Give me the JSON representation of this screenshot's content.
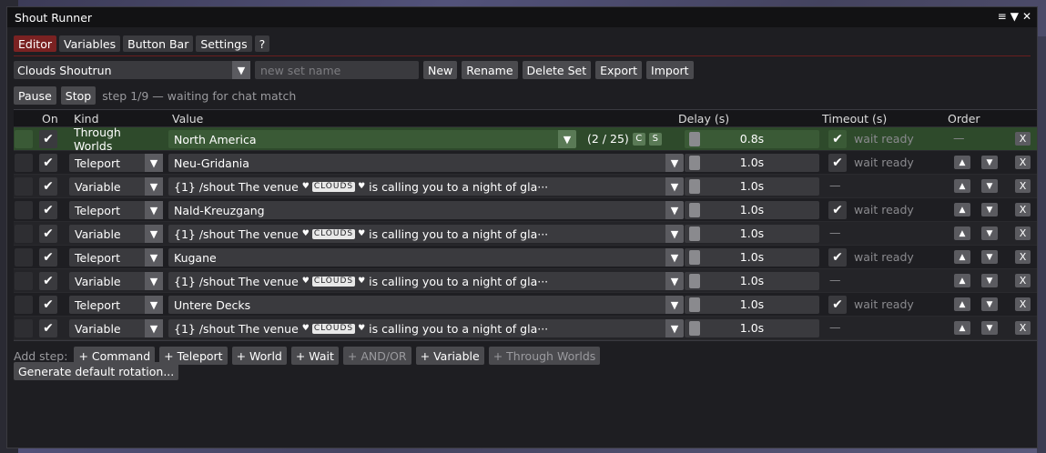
{
  "window": {
    "title": "Shout Runner",
    "icons": [
      "menu-icon",
      "collapse-icon",
      "close-icon"
    ]
  },
  "tabs": [
    "Editor",
    "Variables",
    "Button Bar",
    "Settings",
    "?"
  ],
  "toolbar": {
    "set_name": "Clouds Shoutrun",
    "new_set_placeholder": "new set name",
    "buttons": [
      "New",
      "Rename",
      "Delete Set",
      "Export",
      "Import"
    ]
  },
  "controls": {
    "pause": "Pause",
    "stop": "Stop",
    "status": "step 1/9 — waiting for chat match"
  },
  "columns": {
    "on": "On",
    "kind": "Kind",
    "value": "Value",
    "delay": "Delay (s)",
    "timeout": "Timeout (s)",
    "order": "Order"
  },
  "shout_prefix": "{1} /shout The venue ",
  "shout_clouds": "CLOUDS",
  "shout_suffix": " is calling you to a night of gla···",
  "steps": [
    {
      "kind": "Through Worlds",
      "value": "North America",
      "extra": "(2 / 25)",
      "extra_buttons": [
        "C",
        "S"
      ],
      "delay": "0.8s",
      "timeout": "wait ready",
      "order_dash": "—",
      "highlighted": true
    },
    {
      "kind": "Teleport",
      "value": "Neu-Gridania",
      "delay": "1.0s",
      "timeout": "wait ready"
    },
    {
      "kind": "Variable",
      "shout": true,
      "delay": "1.0s",
      "timeout_dash": "—"
    },
    {
      "kind": "Teleport",
      "value": "Nald-Kreuzgang",
      "delay": "1.0s",
      "timeout": "wait ready"
    },
    {
      "kind": "Variable",
      "shout": true,
      "delay": "1.0s",
      "timeout_dash": "—"
    },
    {
      "kind": "Teleport",
      "value": "Kugane",
      "delay": "1.0s",
      "timeout": "wait ready"
    },
    {
      "kind": "Variable",
      "shout": true,
      "delay": "1.0s",
      "timeout_dash": "—"
    },
    {
      "kind": "Teleport",
      "value": "Untere Decks",
      "delay": "1.0s",
      "timeout": "wait ready"
    },
    {
      "kind": "Variable",
      "shout": true,
      "delay": "1.0s",
      "timeout_dash": "—"
    }
  ],
  "add_step": {
    "label": "Add step:",
    "buttons": [
      {
        "label": "+ Command",
        "enabled": true
      },
      {
        "label": "+ Teleport",
        "enabled": true
      },
      {
        "label": "+ World",
        "enabled": true
      },
      {
        "label": "+ Wait",
        "enabled": true
      },
      {
        "label": "+ AND/OR",
        "enabled": false
      },
      {
        "label": "+ Variable",
        "enabled": true
      },
      {
        "label": "+ Through Worlds",
        "enabled": false
      }
    ]
  },
  "generate_label": "Generate default rotation..."
}
